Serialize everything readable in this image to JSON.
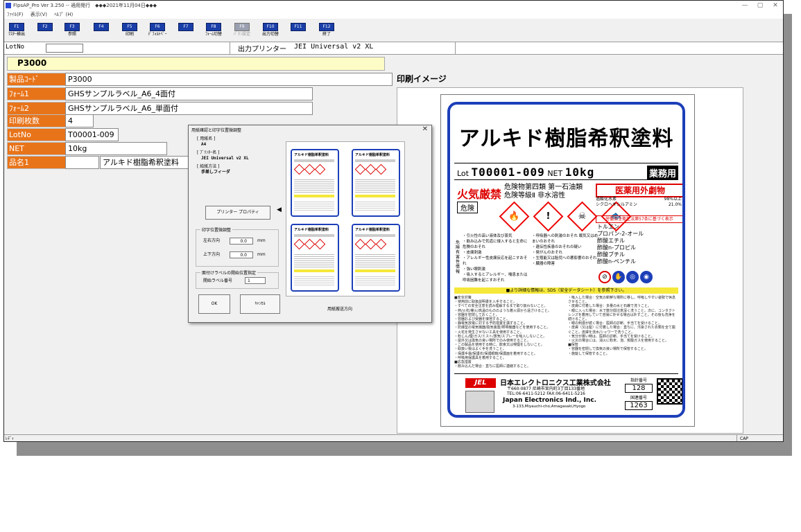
{
  "window": {
    "title": "FlpsAP_Pro  Ver 3.250 -- 適用発行　◆◆◆2021年11月04日◆◆◆",
    "controls": {
      "minimize": "—",
      "maximize": "▢",
      "close": "✕"
    }
  },
  "menu": [
    "ﾌｧｲﾙ(F)",
    "表示(V)",
    "ﾍﾙﾌﾟ (H)"
  ],
  "toolbar": [
    {
      "key": "F1",
      "label": "ﾏｽﾀｰ検出",
      "enabled": true
    },
    {
      "key": "F2",
      "label": "",
      "enabled": true
    },
    {
      "key": "F3",
      "label": "参照",
      "enabled": true
    },
    {
      "key": "F4",
      "label": "",
      "enabled": true
    },
    {
      "key": "F5",
      "label": "印刷",
      "enabled": true
    },
    {
      "key": "F6",
      "label": "ﾃﾞﾌｫﾙﾄﾍﾟｰ",
      "enabled": true
    },
    {
      "key": "F7",
      "label": "",
      "enabled": true
    },
    {
      "key": "F8",
      "label": "ﾌｫｰﾑ切替",
      "enabled": true
    },
    {
      "key": "F9",
      "label": "ﾊﾞﾀﾝ設定",
      "enabled": false
    },
    {
      "key": "F10",
      "label": "出力切替",
      "enabled": true
    },
    {
      "key": "F11",
      "label": "",
      "enabled": true
    },
    {
      "key": "F12",
      "label": "終了",
      "enabled": true
    }
  ],
  "lotbar": {
    "lot_label": "LotNo",
    "lot_value": "",
    "printer_label": "出力プリンター",
    "printer_name": "JEI Universal v2 XL"
  },
  "product_code_display": "P3000",
  "fields": [
    {
      "label": "製品ｺｰﾄﾞ",
      "value": "P3000"
    },
    {
      "label": "ﾌｫｰﾑ1",
      "value": "GHSサンプルラベル_A6_4面付"
    },
    {
      "label": "ﾌｫｰﾑ2",
      "value": "GHSサンプルラベル_A6_単面付"
    },
    {
      "label": "印刷枚数",
      "value": "4"
    },
    {
      "label": "LotNo",
      "value": "T00001-009"
    },
    {
      "label": "NET",
      "value": "10kg"
    },
    {
      "label": "品名1",
      "value": "",
      "value2": "アルキド樹脂希釈塗料"
    }
  ],
  "preview": {
    "title": "印刷イメージ"
  },
  "statusbar": {
    "left": "ﾚﾃﾞｨ",
    "cap": "CAP"
  },
  "dialog": {
    "title": "用紙確認と印字位置微調整",
    "close": "✕",
    "paper_label": "[ 用紙名 ]",
    "paper_value": "A4",
    "printer_label": "[ ﾌﾟﾘﾝﾀｰ名 ]",
    "printer_value": "JEI Universal v2 XL",
    "feed_label": "[ 給紙方法 ]",
    "feed_value": "手差しフィーダ",
    "printer_props_btn": "プリンター プロパティ",
    "arrow": "◀",
    "adjust_group": "印字位置微調整",
    "lr_label": "左右方向",
    "lr_value": "0.0",
    "ud_label": "上下方向",
    "ud_value": "0.0",
    "unit": "mm",
    "start_group": "面付けラベルの開始位置指定",
    "start_label": "開始ラベル番号",
    "start_value": "1",
    "ok": "OK",
    "cancel": "ｷｬﾝｾﾙ",
    "feed_dir": "用紙搬送方向",
    "mini_title": "アルキド樹脂希釈塗料"
  },
  "label": {
    "product_name": "アルキド樹脂希釈塗料",
    "lot_prefix": "Lot",
    "lot": "T00001-009",
    "net_prefix": "NET",
    "net": "10kg",
    "business_use": "業務用",
    "fire_warning": "火気厳禁",
    "category1": "危険物第四類 第一石油類",
    "category2": "危険等級Ⅱ 非水溶性",
    "signal_word": "危険",
    "pictograms": [
      "🔥",
      "!",
      "☠",
      "🐟"
    ],
    "poison_title": "医薬用外劇物",
    "components": [
      {
        "name": "過酸化水素",
        "pct": "98%以上"
      },
      {
        "name": "シクロヘキシルアミン",
        "pct": "21.0%"
      }
    ],
    "law_title": "労働安全衛生法第57条に基づく表示",
    "chemicals": [
      "トルエン",
      "プロパン-2-オール",
      "酢酸エチル",
      "酢酸n-プロピル",
      "酢酸ブチル",
      "酢酸n-ペンチル"
    ],
    "hazard_side": "危険有害性情報",
    "hazards": [
      "・引火性の高い液体及び蒸気",
      "・飲み込みで気道に侵入すると生命に危険のおそれ",
      "・皮膚刺激",
      "・アレルギー性皮膚反応を起こすおそれ",
      "・強い眼刺激",
      "・吸入するとアレルギー、喘息または呼吸困難を起こすおそれ",
      "・呼吸器への刺激のおそれ 眠気又はめまいのおそれ",
      "・遺伝性疾患のおそれの疑い",
      "・発がんのおそれ",
      "・生殖能又は胎児への悪影響のおそれ",
      "・臓器の障害"
    ],
    "sds_note": "■より詳細な情報は、SDS（安全データシート）を参照下さい。",
    "precautions_left": [
      "■安全対策",
      "・使用前に取扱説明書を入手すること。",
      "・すべての安全注意を読み理解するまで取り扱わないこと。",
      "・熱/火花/裸火/高温のもののような着火源から遠ざけること。",
      "・容器を密閉しておくこと。",
      "・容器および受器を接地すること。",
      "・静電気放電に対する予防措置を講ずること。",
      "・防爆型の電気機器/換気装置/照明機器などを使用すること。",
      "・火花を発生させない工具を使用すること。",
      "・粉じん/煙/ガス/ミスト/蒸気/スプレーを吸入しないこと。",
      "・屋外又は換気の良い場所でのみ使用すること。",
      "・この製品を使用する時に、飲食又は喫煙をしないこと。",
      "・取扱い後はよく手を洗うこと。",
      "・保護手袋/保護衣/保護眼鏡/保護面を着用すること。",
      "・呼吸用保護具を着用すること。",
      "■応急措置",
      "・飲み込んだ場合：直ちに医師に連絡すること。"
    ],
    "precautions_right": [
      "・吸入した場合：空気の新鮮な場所に移し、呼吸しやすい姿勢で休息させること。",
      "・皮膚に付着した場合：多量の水と石鹸で洗うこと。",
      "・眼に入った場合：水で数分間注意深く洗うこと。次に、コンタクトレンズを着用していて容易に外せる場合は外すこと。その後も洗浄を続けること。",
      "・眼の刺激が続く場合：医師の診断、手当てを受けること。",
      "・皮膚（又は髪）に付着した場合：直ちに、汚染された衣類を全て脱ぐこと。皮膚を流水/シャワーで洗うこと。",
      "・気分が悪い時は、医師の診断、手当てを受けること。",
      "・火災の場合には、消火に粉末、泡、炭酸ガスを使用すること。",
      "■保管",
      "・容器を密閉して換気の良い場所で保管すること。",
      "・施錠して保管すること。"
    ],
    "maker_logo": "JEL",
    "company_ja": "日本エレクトロニクス工業株式会社",
    "address1": "〒660-0877 尼崎市宮内町3丁目133番地",
    "address2": "TEL:06-6411-5212 FAX:06-6411-5216",
    "company_en": "Japan Electronics Ind., Inc.",
    "address_en": "3-133,Miyauchi-cho,Amagasaki,Hyogo",
    "guide_label": "指針番号",
    "guide_no": "128",
    "un_label": "国連番号",
    "un_no": "1263"
  }
}
